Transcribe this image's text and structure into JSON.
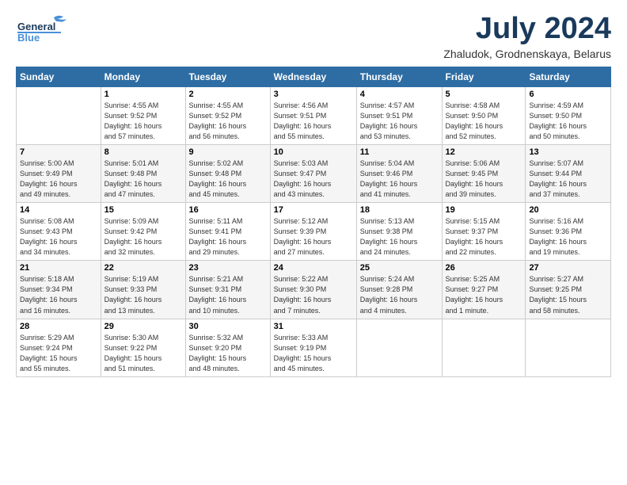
{
  "logo": {
    "line1": "General",
    "line2": "Blue"
  },
  "title": "July 2024",
  "location": "Zhaludok, Grodnenskaya, Belarus",
  "weekdays": [
    "Sunday",
    "Monday",
    "Tuesday",
    "Wednesday",
    "Thursday",
    "Friday",
    "Saturday"
  ],
  "weeks": [
    [
      {
        "day": "",
        "info": ""
      },
      {
        "day": "1",
        "info": "Sunrise: 4:55 AM\nSunset: 9:52 PM\nDaylight: 16 hours\nand 57 minutes."
      },
      {
        "day": "2",
        "info": "Sunrise: 4:55 AM\nSunset: 9:52 PM\nDaylight: 16 hours\nand 56 minutes."
      },
      {
        "day": "3",
        "info": "Sunrise: 4:56 AM\nSunset: 9:51 PM\nDaylight: 16 hours\nand 55 minutes."
      },
      {
        "day": "4",
        "info": "Sunrise: 4:57 AM\nSunset: 9:51 PM\nDaylight: 16 hours\nand 53 minutes."
      },
      {
        "day": "5",
        "info": "Sunrise: 4:58 AM\nSunset: 9:50 PM\nDaylight: 16 hours\nand 52 minutes."
      },
      {
        "day": "6",
        "info": "Sunrise: 4:59 AM\nSunset: 9:50 PM\nDaylight: 16 hours\nand 50 minutes."
      }
    ],
    [
      {
        "day": "7",
        "info": "Sunrise: 5:00 AM\nSunset: 9:49 PM\nDaylight: 16 hours\nand 49 minutes."
      },
      {
        "day": "8",
        "info": "Sunrise: 5:01 AM\nSunset: 9:48 PM\nDaylight: 16 hours\nand 47 minutes."
      },
      {
        "day": "9",
        "info": "Sunrise: 5:02 AM\nSunset: 9:48 PM\nDaylight: 16 hours\nand 45 minutes."
      },
      {
        "day": "10",
        "info": "Sunrise: 5:03 AM\nSunset: 9:47 PM\nDaylight: 16 hours\nand 43 minutes."
      },
      {
        "day": "11",
        "info": "Sunrise: 5:04 AM\nSunset: 9:46 PM\nDaylight: 16 hours\nand 41 minutes."
      },
      {
        "day": "12",
        "info": "Sunrise: 5:06 AM\nSunset: 9:45 PM\nDaylight: 16 hours\nand 39 minutes."
      },
      {
        "day": "13",
        "info": "Sunrise: 5:07 AM\nSunset: 9:44 PM\nDaylight: 16 hours\nand 37 minutes."
      }
    ],
    [
      {
        "day": "14",
        "info": "Sunrise: 5:08 AM\nSunset: 9:43 PM\nDaylight: 16 hours\nand 34 minutes."
      },
      {
        "day": "15",
        "info": "Sunrise: 5:09 AM\nSunset: 9:42 PM\nDaylight: 16 hours\nand 32 minutes."
      },
      {
        "day": "16",
        "info": "Sunrise: 5:11 AM\nSunset: 9:41 PM\nDaylight: 16 hours\nand 29 minutes."
      },
      {
        "day": "17",
        "info": "Sunrise: 5:12 AM\nSunset: 9:39 PM\nDaylight: 16 hours\nand 27 minutes."
      },
      {
        "day": "18",
        "info": "Sunrise: 5:13 AM\nSunset: 9:38 PM\nDaylight: 16 hours\nand 24 minutes."
      },
      {
        "day": "19",
        "info": "Sunrise: 5:15 AM\nSunset: 9:37 PM\nDaylight: 16 hours\nand 22 minutes."
      },
      {
        "day": "20",
        "info": "Sunrise: 5:16 AM\nSunset: 9:36 PM\nDaylight: 16 hours\nand 19 minutes."
      }
    ],
    [
      {
        "day": "21",
        "info": "Sunrise: 5:18 AM\nSunset: 9:34 PM\nDaylight: 16 hours\nand 16 minutes."
      },
      {
        "day": "22",
        "info": "Sunrise: 5:19 AM\nSunset: 9:33 PM\nDaylight: 16 hours\nand 13 minutes."
      },
      {
        "day": "23",
        "info": "Sunrise: 5:21 AM\nSunset: 9:31 PM\nDaylight: 16 hours\nand 10 minutes."
      },
      {
        "day": "24",
        "info": "Sunrise: 5:22 AM\nSunset: 9:30 PM\nDaylight: 16 hours\nand 7 minutes."
      },
      {
        "day": "25",
        "info": "Sunrise: 5:24 AM\nSunset: 9:28 PM\nDaylight: 16 hours\nand 4 minutes."
      },
      {
        "day": "26",
        "info": "Sunrise: 5:25 AM\nSunset: 9:27 PM\nDaylight: 16 hours\nand 1 minute."
      },
      {
        "day": "27",
        "info": "Sunrise: 5:27 AM\nSunset: 9:25 PM\nDaylight: 15 hours\nand 58 minutes."
      }
    ],
    [
      {
        "day": "28",
        "info": "Sunrise: 5:29 AM\nSunset: 9:24 PM\nDaylight: 15 hours\nand 55 minutes."
      },
      {
        "day": "29",
        "info": "Sunrise: 5:30 AM\nSunset: 9:22 PM\nDaylight: 15 hours\nand 51 minutes."
      },
      {
        "day": "30",
        "info": "Sunrise: 5:32 AM\nSunset: 9:20 PM\nDaylight: 15 hours\nand 48 minutes."
      },
      {
        "day": "31",
        "info": "Sunrise: 5:33 AM\nSunset: 9:19 PM\nDaylight: 15 hours\nand 45 minutes."
      },
      {
        "day": "",
        "info": ""
      },
      {
        "day": "",
        "info": ""
      },
      {
        "day": "",
        "info": ""
      }
    ]
  ]
}
